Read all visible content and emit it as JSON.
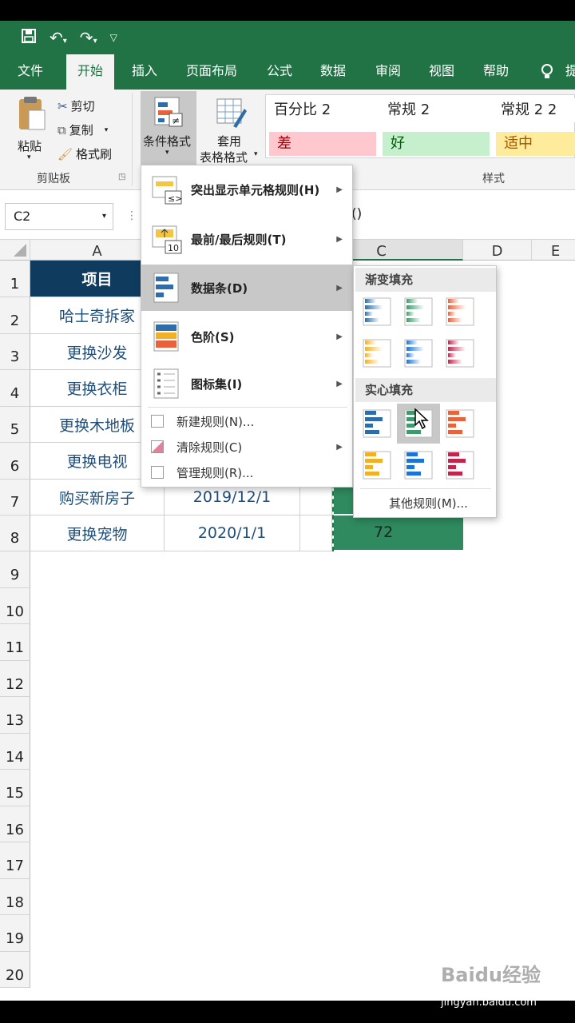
{
  "quick_access": {
    "save": "save-icon",
    "undo": "undo-icon",
    "redo": "redo-icon",
    "customize": "customize-icon"
  },
  "tabs": [
    "文件",
    "开始",
    "插入",
    "页面布局",
    "公式",
    "数据",
    "审阅",
    "视图",
    "帮助",
    "提"
  ],
  "ribbon": {
    "paste": "粘贴",
    "cut": "剪切",
    "copy": "复制",
    "format_painter": "格式刷",
    "clipboard_group": "剪贴板",
    "conditional_format": "条件格式",
    "table_format_1": "套用",
    "table_format_2": "表格格式",
    "styles_group": "样式",
    "styles": [
      {
        "label": "百分比 2",
        "bg": "#ffffff",
        "fg": "#222222"
      },
      {
        "label": "常规 2",
        "bg": "#ffffff",
        "fg": "#222222"
      },
      {
        "label": "常规 2 2",
        "bg": "#ffffff",
        "fg": "#222222"
      },
      {
        "label": "差",
        "bg": "#ffc7ce",
        "fg": "#9c0006"
      },
      {
        "label": "好",
        "bg": "#c6efce",
        "fg": "#006100"
      },
      {
        "label": "适中",
        "bg": "#ffeb9c",
        "fg": "#9c5700"
      }
    ]
  },
  "formula_bar": {
    "name_box": "C2",
    "formula": "()"
  },
  "columns": [
    "A",
    "C",
    "D",
    "E"
  ],
  "rows": [
    "1",
    "2",
    "3",
    "4",
    "5",
    "6",
    "7",
    "8",
    "9",
    "10",
    "11",
    "12",
    "13",
    "14",
    "15",
    "16",
    "17",
    "18",
    "19",
    "20"
  ],
  "table": {
    "header": "项目",
    "items": [
      "哈士奇拆家",
      "更换沙发",
      "更换衣柜",
      "更换木地板",
      "更换电视",
      "购买新房子",
      "更换宠物"
    ],
    "dates": {
      "r7": "2019/12/1",
      "r8": "2020/1/1"
    },
    "c8_value": "72"
  },
  "cf_menu": {
    "items": [
      "突出显示单元格规则(H)",
      "最前/最后规则(T)",
      "数据条(D)",
      "色阶(S)",
      "图标集(I)"
    ],
    "small_items": [
      "新建规则(N)...",
      "清除规则(C)",
      "管理规则(R)..."
    ]
  },
  "databar_menu": {
    "gradient_title": "渐变填充",
    "solid_title": "实心填充",
    "more_rules": "其他规则(M)...",
    "colors": [
      "#2f6da8",
      "#3f9a6b",
      "#e8623c",
      "#f2b124",
      "#1d73d6",
      "#c2254a"
    ]
  },
  "watermark": {
    "brand": "Baidu经验",
    "url": "jingyan.baidu.com"
  }
}
